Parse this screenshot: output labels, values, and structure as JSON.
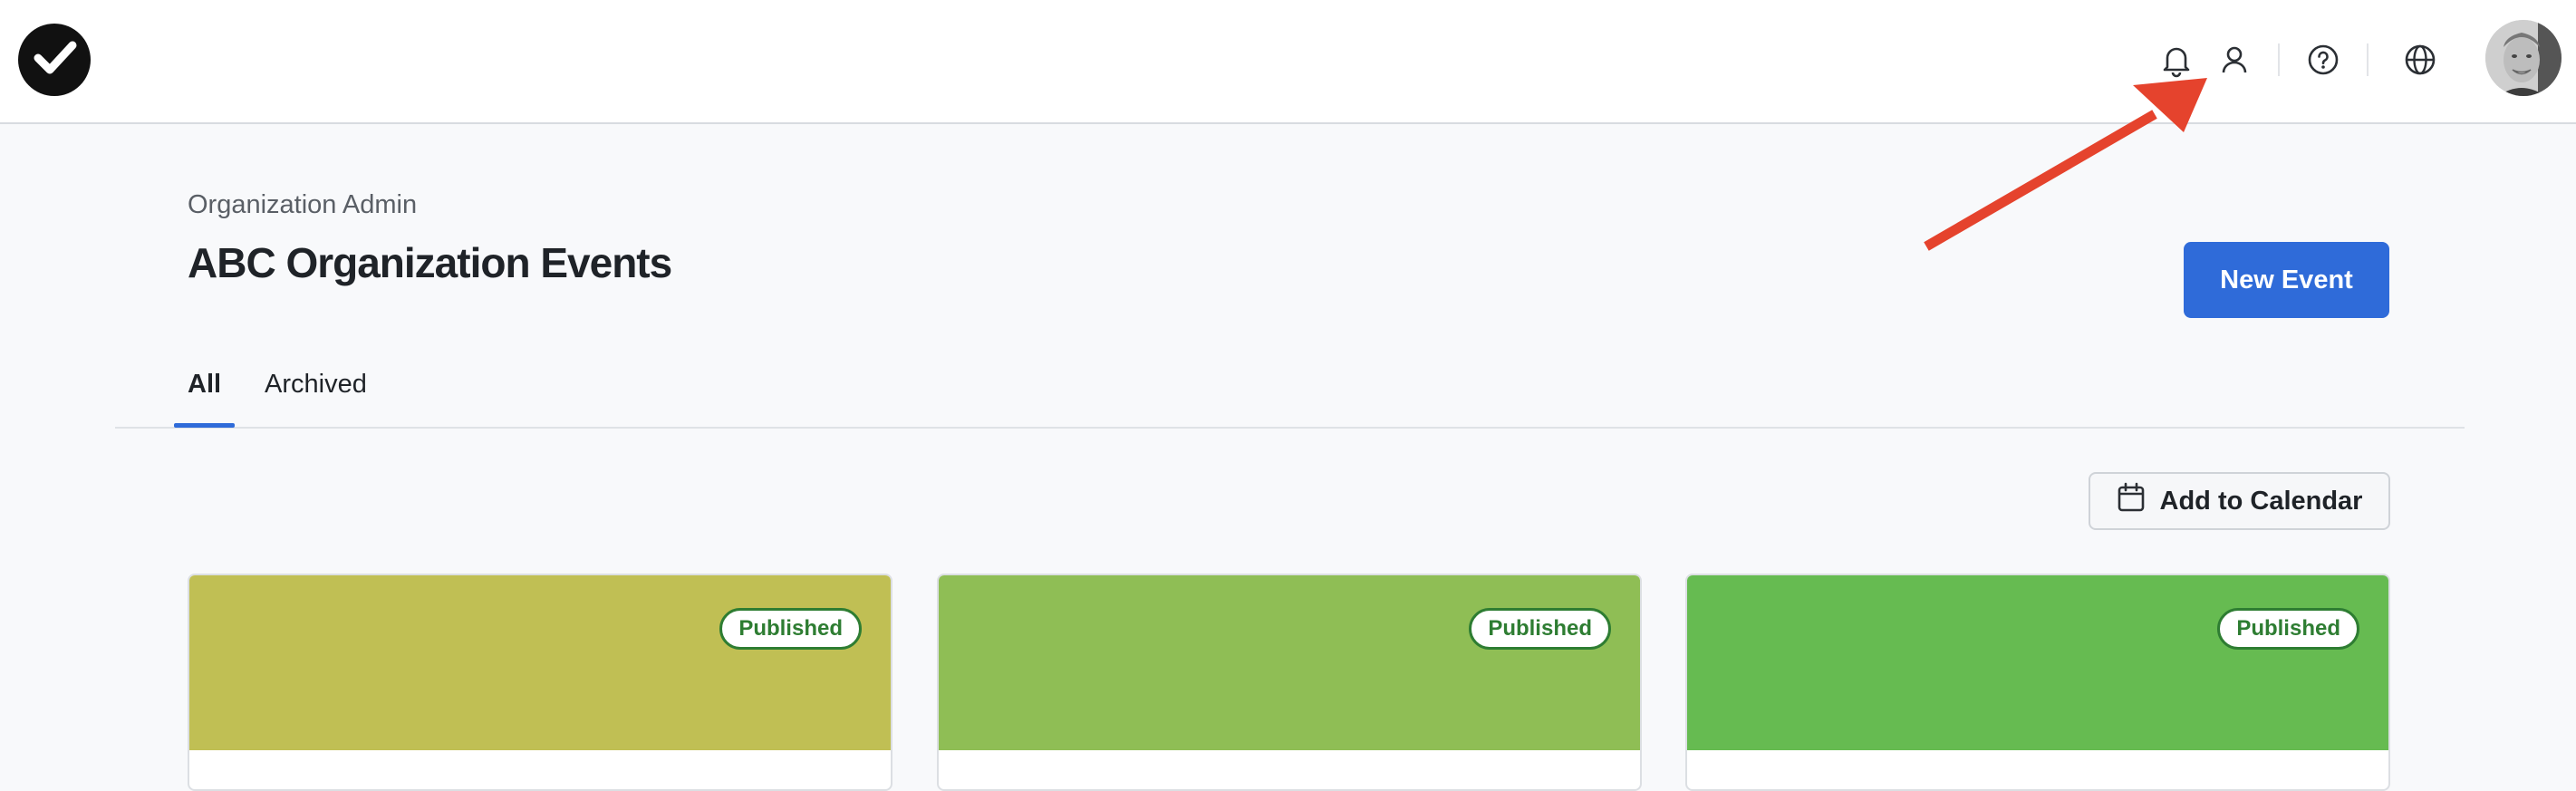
{
  "header": {
    "icons": [
      "app-logo-icon",
      "bell-icon",
      "user-icon",
      "help-icon",
      "globe-icon"
    ]
  },
  "page": {
    "breadcrumb": "Organization Admin",
    "title": "ABC Organization Events",
    "new_event_label": "New Event"
  },
  "tabs": [
    {
      "label": "All",
      "active": true
    },
    {
      "label": "Archived",
      "active": false
    }
  ],
  "toolbar": {
    "add_to_calendar_label": "Add to Calendar"
  },
  "events": [
    {
      "status": "Published",
      "color": "#c0bf54"
    },
    {
      "status": "Published",
      "color": "#8fbe55"
    },
    {
      "status": "Published",
      "color": "#66bb51"
    }
  ],
  "colors": {
    "accent": "#2f6bd9",
    "annotation_arrow": "#e5432d",
    "published": "#2e7d32"
  }
}
